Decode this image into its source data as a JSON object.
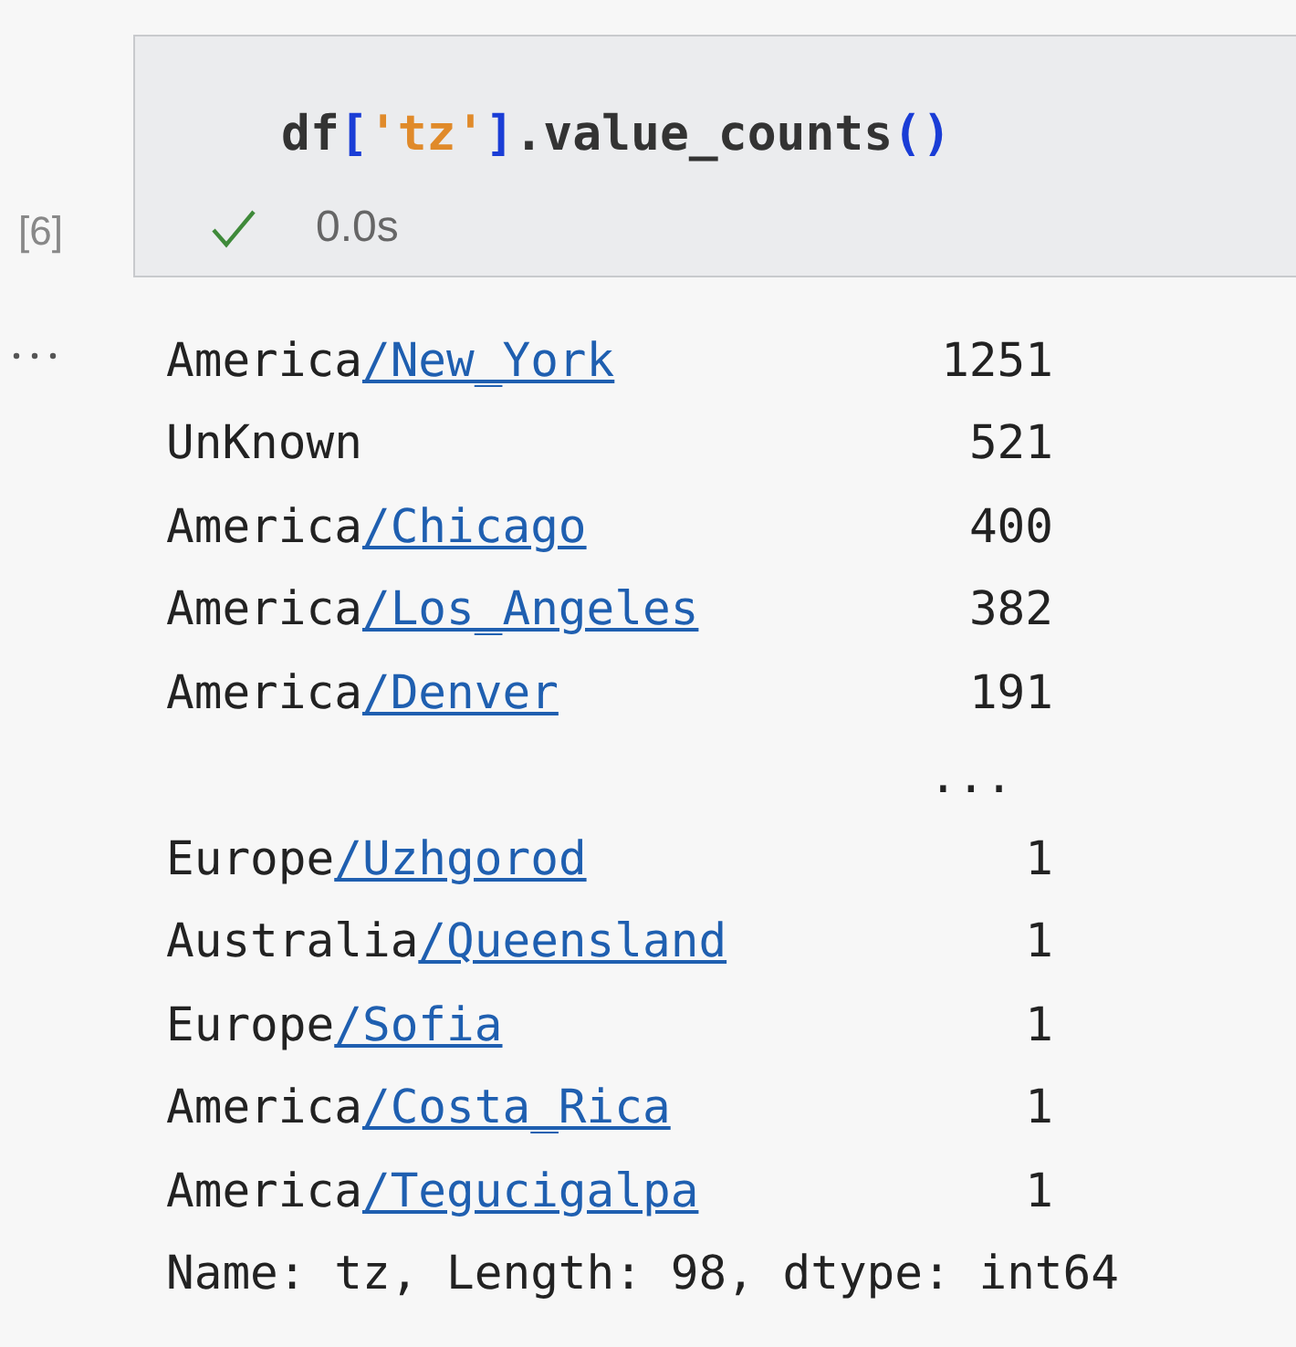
{
  "cell": {
    "execution_count": "[6]",
    "code": [
      {
        "kind": "plain",
        "text": "df"
      },
      {
        "kind": "bracket",
        "text": "["
      },
      {
        "kind": "string",
        "text": "'tz'"
      },
      {
        "kind": "bracket",
        "text": "]"
      },
      {
        "kind": "plain",
        "text": ".value_counts"
      },
      {
        "kind": "bracket",
        "text": "()"
      }
    ],
    "status": {
      "succeeded": true,
      "duration": "0.0s"
    }
  },
  "output": {
    "rows": [
      {
        "kind": "entry",
        "prefix": "America",
        "link": "/New_York",
        "count": "1251"
      },
      {
        "kind": "entry",
        "prefix": "UnKnown",
        "count": "521"
      },
      {
        "kind": "entry",
        "prefix": "America",
        "link": "/Chicago",
        "count": "400"
      },
      {
        "kind": "entry",
        "prefix": "America",
        "link": "/Los_Angeles",
        "count": "382"
      },
      {
        "kind": "entry",
        "prefix": "America",
        "link": "/Denver",
        "count": "191"
      },
      {
        "kind": "ellipsis",
        "count": "..."
      },
      {
        "kind": "entry",
        "prefix": "Europe",
        "link": "/Uzhgorod",
        "count": "1"
      },
      {
        "kind": "entry",
        "prefix": "Australia",
        "link": "/Queensland",
        "count": "1"
      },
      {
        "kind": "entry",
        "prefix": "Europe",
        "link": "/Sofia",
        "count": "1"
      },
      {
        "kind": "entry",
        "prefix": "America",
        "link": "/Costa_Rica",
        "count": "1"
      },
      {
        "kind": "entry",
        "prefix": "America",
        "link": "/Tegucigalpa",
        "count": "1"
      }
    ],
    "footer": "Name: tz, Length: 98, dtype: int64"
  }
}
